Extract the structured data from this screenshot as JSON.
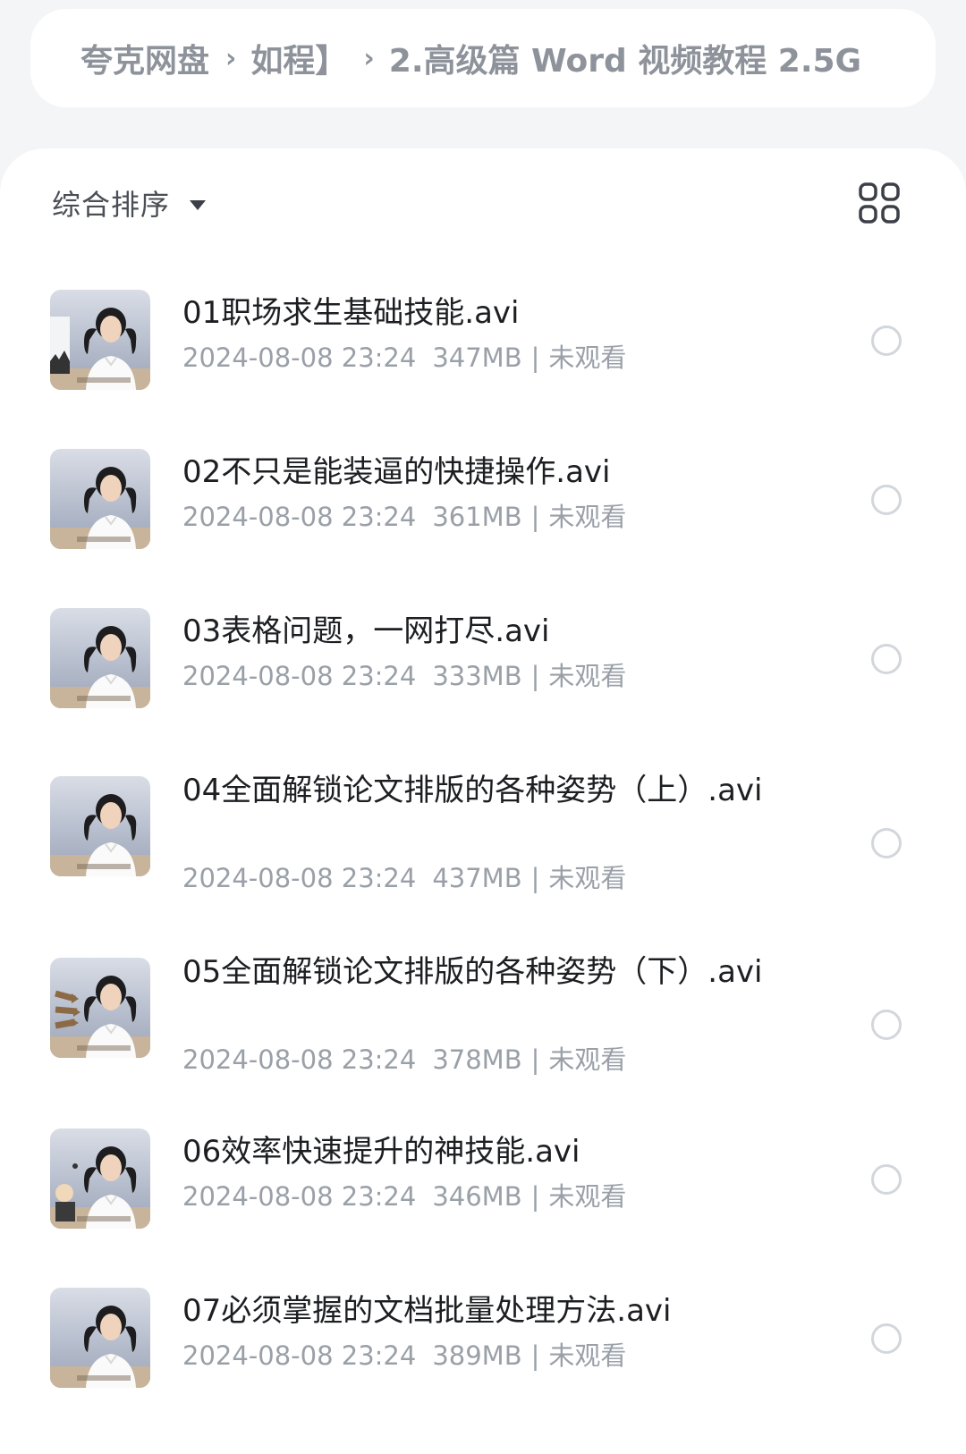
{
  "breadcrumb": {
    "root": "夸克网盘",
    "middle": "如程】",
    "current": "2.高级篇 Word 视频教程 2.5G",
    "separator_icon": "chevron-right-icon"
  },
  "toolbar": {
    "sort_label": "综合排序",
    "sort_icon": "caret-down-icon",
    "view_icon": "grid-view-icon"
  },
  "files": [
    {
      "name": "01职场求生基础技能.avi",
      "date": "2024-08-08 23:24",
      "size": "347MB",
      "status": "未观看"
    },
    {
      "name": "02不只是能装逼的快捷操作.avi",
      "date": "2024-08-08 23:24",
      "size": "361MB",
      "status": "未观看"
    },
    {
      "name": "03表格问题，一网打尽.avi",
      "date": "2024-08-08 23:24",
      "size": "333MB",
      "status": "未观看"
    },
    {
      "name": "04全面解锁论文排版的各种姿势（上）.avi",
      "date": "2024-08-08 23:24",
      "size": "437MB",
      "status": "未观看"
    },
    {
      "name": "05全面解锁论文排版的各种姿势（下）.avi",
      "date": "2024-08-08 23:24",
      "size": "378MB",
      "status": "未观看"
    },
    {
      "name": "06效率快速提升的神技能.avi",
      "date": "2024-08-08 23:24",
      "size": "346MB",
      "status": "未观看"
    },
    {
      "name": "07必须掌握的文档批量处理方法.avi",
      "date": "2024-08-08 23:24",
      "size": "389MB",
      "status": "未观看"
    }
  ],
  "meta_separator": "|",
  "colors": {
    "accent_text": "#1c1e22",
    "muted_text": "#9aa0a8",
    "background": "#f4f5f7"
  }
}
